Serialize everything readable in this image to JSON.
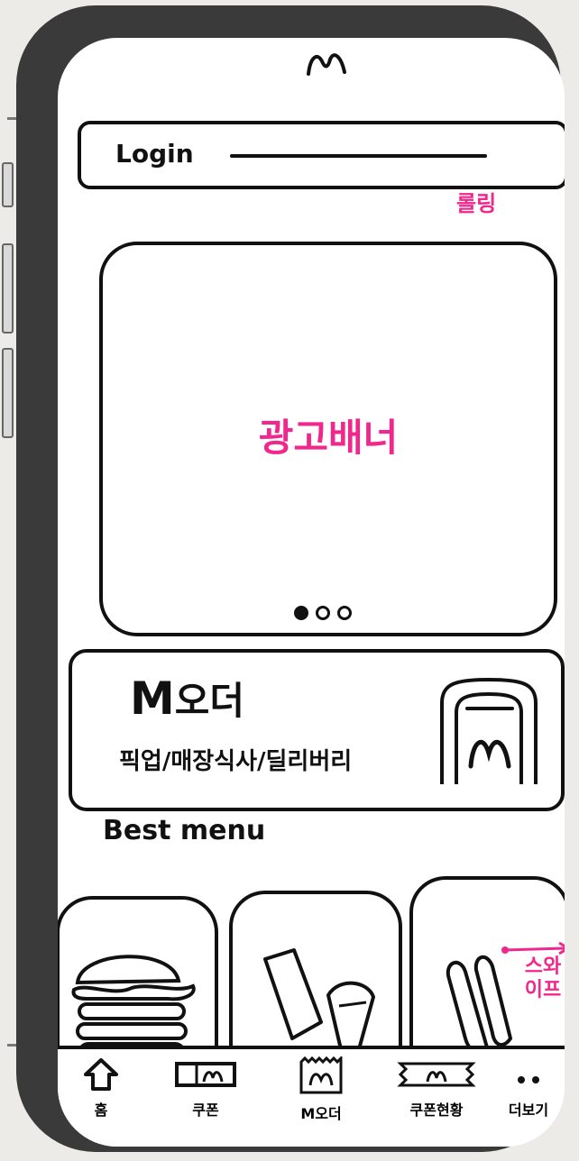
{
  "header": {
    "logo": "M"
  },
  "login": {
    "label": "Login"
  },
  "annotations": {
    "login_rolling": "롤링",
    "swipe": "스와이프"
  },
  "banner": {
    "label": "광고배너",
    "pages": 3,
    "active_page": 1
  },
  "m_order": {
    "logo": "M",
    "title": "오더",
    "options": "픽업/매장식사/딜리버리"
  },
  "best_menu": {
    "heading": "Best menu",
    "items": [
      {
        "icon": "burger-icon"
      },
      {
        "icon": "drink-and-fries-icon"
      },
      {
        "icon": "fries-icon"
      }
    ]
  },
  "tabbar": {
    "items": [
      {
        "label": "홈",
        "icon": "home-icon"
      },
      {
        "label": "쿠폰",
        "icon": "coupon-icon"
      },
      {
        "label": "M오더",
        "icon": "m-order-icon"
      },
      {
        "label": "쿠폰현황",
        "icon": "coupon-status-icon"
      },
      {
        "label": "더보기",
        "icon": "more-icon"
      }
    ]
  },
  "colors": {
    "sketch": "#111111",
    "annotation": "#f0278c",
    "frame": "#3a3a3a"
  }
}
